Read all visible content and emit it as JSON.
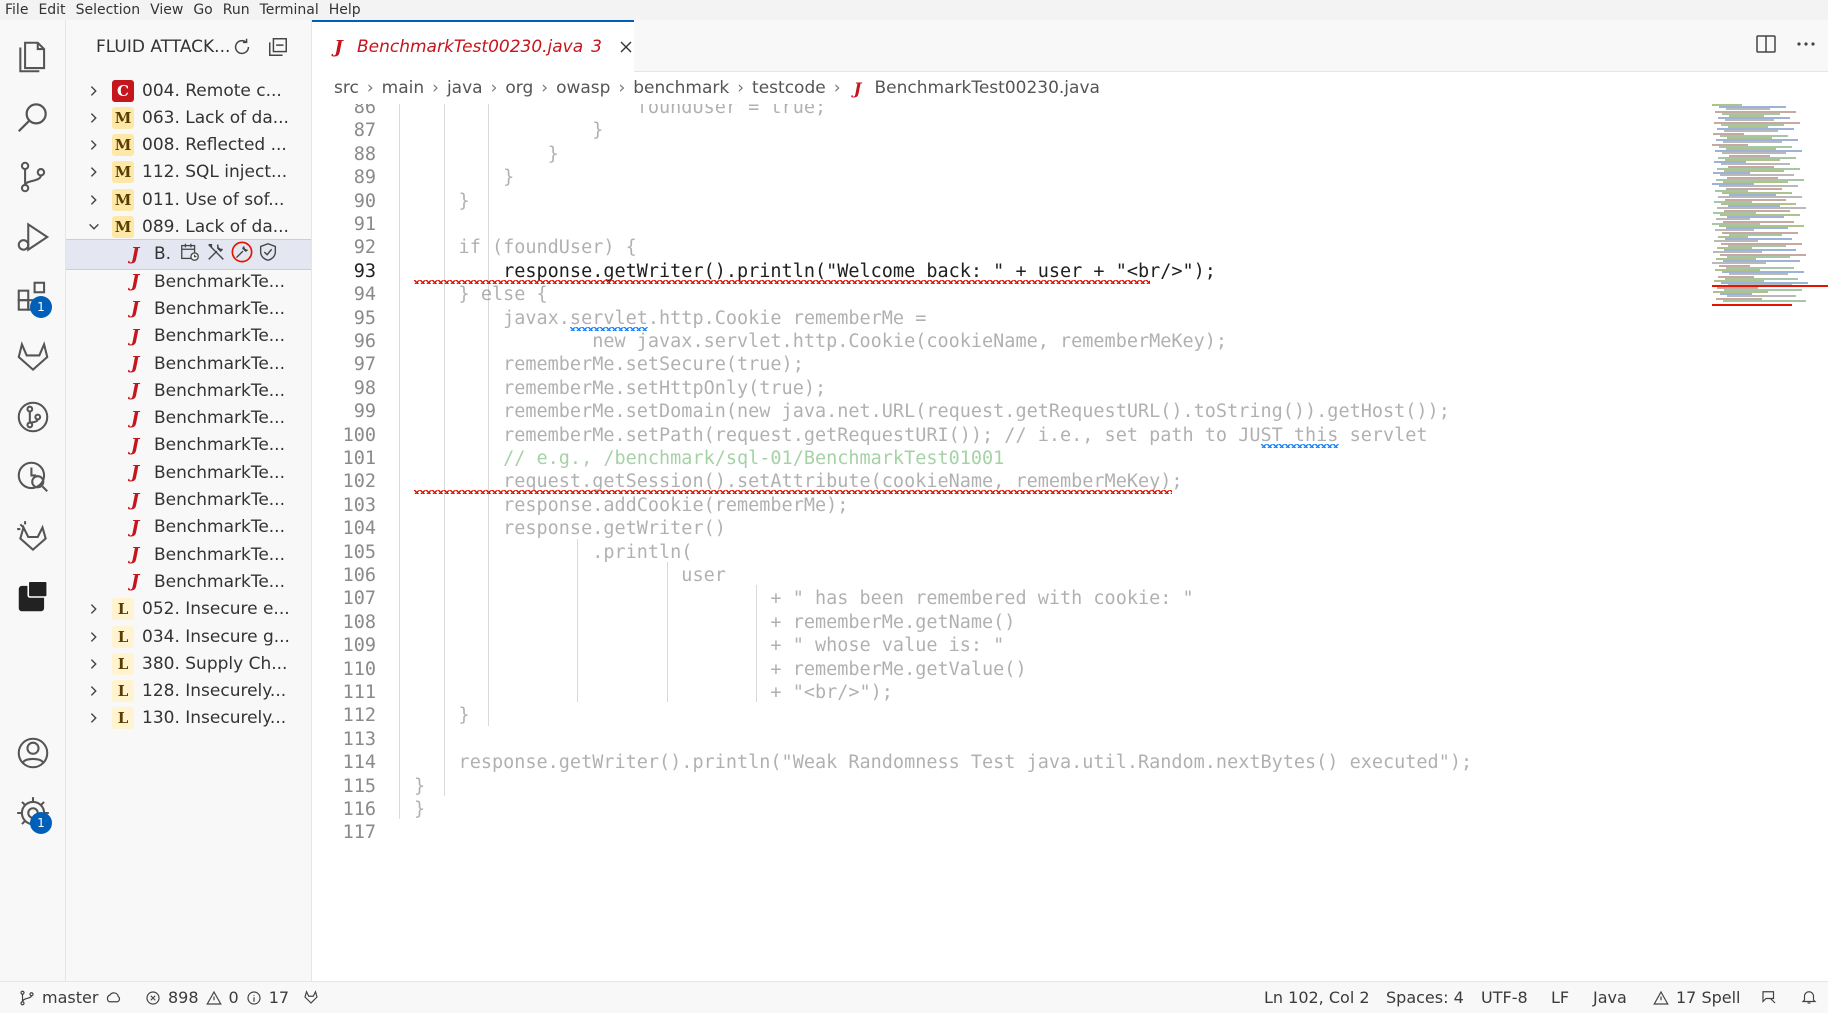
{
  "menu": [
    "File",
    "Edit",
    "Selection",
    "View",
    "Go",
    "Run",
    "Terminal",
    "Help"
  ],
  "activity": {
    "extensions_badge": "1",
    "settings_badge": "1"
  },
  "sidebar": {
    "title": "FLUID ATTACK...",
    "items": [
      {
        "type": "group",
        "sev": "C",
        "label": "004. Remote c...",
        "expanded": false
      },
      {
        "type": "group",
        "sev": "M",
        "label": "063. Lack of da...",
        "expanded": false
      },
      {
        "type": "group",
        "sev": "M",
        "label": "008. Reflected ...",
        "expanded": false
      },
      {
        "type": "group",
        "sev": "M",
        "label": "112. SQL inject...",
        "expanded": false
      },
      {
        "type": "group",
        "sev": "M",
        "label": "011. Use of sof...",
        "expanded": false
      },
      {
        "type": "group",
        "sev": "M",
        "label": "089. Lack of da...",
        "expanded": true
      },
      {
        "type": "file",
        "label": "B.",
        "selected": true
      },
      {
        "type": "file",
        "label": "BenchmarkTe..."
      },
      {
        "type": "file",
        "label": "BenchmarkTe..."
      },
      {
        "type": "file",
        "label": "BenchmarkTe..."
      },
      {
        "type": "file",
        "label": "BenchmarkTe..."
      },
      {
        "type": "file",
        "label": "BenchmarkTe..."
      },
      {
        "type": "file",
        "label": "BenchmarkTe..."
      },
      {
        "type": "file",
        "label": "BenchmarkTe..."
      },
      {
        "type": "file",
        "label": "BenchmarkTe..."
      },
      {
        "type": "file",
        "label": "BenchmarkTe..."
      },
      {
        "type": "file",
        "label": "BenchmarkTe..."
      },
      {
        "type": "file",
        "label": "BenchmarkTe..."
      },
      {
        "type": "file",
        "label": "BenchmarkTe..."
      },
      {
        "type": "group",
        "sev": "L",
        "label": "052. Insecure e...",
        "expanded": false
      },
      {
        "type": "group",
        "sev": "L",
        "label": "034. Insecure g...",
        "expanded": false
      },
      {
        "type": "group",
        "sev": "L",
        "label": "380. Supply Ch...",
        "expanded": false
      },
      {
        "type": "group",
        "sev": "L",
        "label": "128. Insecurely...",
        "expanded": false
      },
      {
        "type": "group",
        "sev": "L",
        "label": "130. Insecurely...",
        "expanded": false
      }
    ]
  },
  "tab": {
    "icon": "J",
    "label": "BenchmarkTest00230.java",
    "problems": "3"
  },
  "breadcrumb": [
    "src",
    "main",
    "java",
    "org",
    "owasp",
    "benchmark",
    "testcode",
    "BenchmarkTest00230.java"
  ],
  "code": {
    "current_line": "93",
    "lines": [
      {
        "n": "86",
        "text": "                    foundUser = true;",
        "dim": true
      },
      {
        "n": "87",
        "text": "                }",
        "dim": true
      },
      {
        "n": "88",
        "text": "            }",
        "dim": true
      },
      {
        "n": "89",
        "text": "        }",
        "dim": true
      },
      {
        "n": "90",
        "text": "    }",
        "dim": true
      },
      {
        "n": "91",
        "text": "",
        "dim": true
      },
      {
        "n": "92",
        "text": "    if (foundUser) {",
        "dim": true
      },
      {
        "n": "93",
        "text": "        response.getWriter().println(\"Welcome back: \" + user + \"<br/>\");",
        "dim": false
      },
      {
        "n": "94",
        "text": "    } else {",
        "dim": true
      },
      {
        "n": "95",
        "text": "        javax.servlet.http.Cookie rememberMe =",
        "dim": true
      },
      {
        "n": "96",
        "text": "                new javax.servlet.http.Cookie(cookieName, rememberMeKey);",
        "dim": true
      },
      {
        "n": "97",
        "text": "        rememberMe.setSecure(true);",
        "dim": true
      },
      {
        "n": "98",
        "text": "        rememberMe.setHttpOnly(true);",
        "dim": true
      },
      {
        "n": "99",
        "text": "        rememberMe.setDomain(new java.net.URL(request.getRequestURL().toString()).getHost());",
        "dim": true
      },
      {
        "n": "100",
        "text": "        rememberMe.setPath(request.getRequestURI()); // i.e., set path to JUST this servlet",
        "dim": true
      },
      {
        "n": "101",
        "text": "        // e.g., /benchmark/sql-01/BenchmarkTest01001",
        "dim": true
      },
      {
        "n": "102",
        "text": "        request.getSession().setAttribute(cookieName, rememberMeKey);",
        "dim": true
      },
      {
        "n": "103",
        "text": "        response.addCookie(rememberMe);",
        "dim": true
      },
      {
        "n": "104",
        "text": "        response.getWriter()",
        "dim": true
      },
      {
        "n": "105",
        "text": "                .println(",
        "dim": true
      },
      {
        "n": "106",
        "text": "                        user",
        "dim": true
      },
      {
        "n": "107",
        "text": "                                + \" has been remembered with cookie: \"",
        "dim": true
      },
      {
        "n": "108",
        "text": "                                + rememberMe.getName()",
        "dim": true
      },
      {
        "n": "109",
        "text": "                                + \" whose value is: \"",
        "dim": true
      },
      {
        "n": "110",
        "text": "                                + rememberMe.getValue()",
        "dim": true
      },
      {
        "n": "111",
        "text": "                                + \"<br/>\");",
        "dim": true
      },
      {
        "n": "112",
        "text": "    }",
        "dim": true
      },
      {
        "n": "113",
        "text": "",
        "dim": true
      },
      {
        "n": "114",
        "text": "    response.getWriter().println(\"Weak Randomness Test java.util.Random.nextBytes() executed\");",
        "dim": true
      },
      {
        "n": "115",
        "text": "}",
        "dim": true
      },
      {
        "n": "116",
        "text": "}",
        "dim": true
      },
      {
        "n": "117",
        "text": "",
        "dim": true
      }
    ]
  },
  "status": {
    "branch": "master",
    "errors": "898",
    "warnings": "0",
    "info": "17",
    "position": "Ln 102, Col 2",
    "spaces": "Spaces: 4",
    "encoding": "UTF-8",
    "eol": "LF",
    "language": "Java",
    "spell": "17 Spell"
  },
  "colors": {
    "accent": "#005fb8",
    "error": "#e51400",
    "critical": "#c4161c"
  }
}
